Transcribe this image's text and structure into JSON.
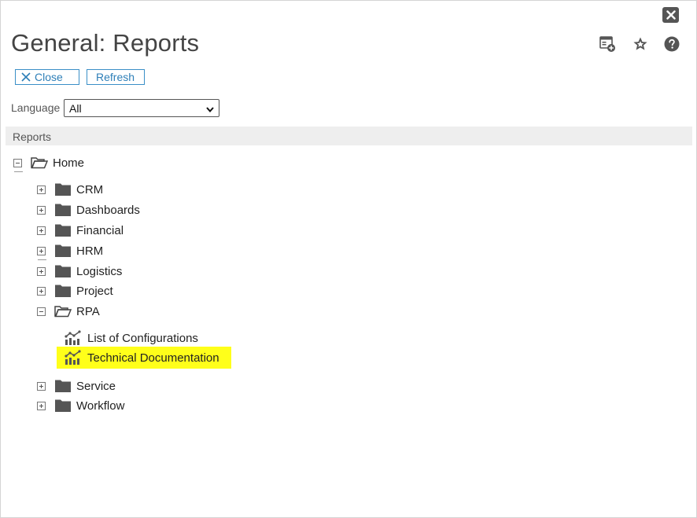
{
  "window": {
    "title": "General: Reports"
  },
  "toolbar": {
    "close_label": "Close",
    "refresh_label": "Refresh"
  },
  "filter": {
    "language_label": "Language",
    "language_value": "All"
  },
  "section": {
    "header": "Reports"
  },
  "tree": {
    "root": "Home",
    "folders": [
      {
        "label": "CRM",
        "expanded": false
      },
      {
        "label": "Dashboards",
        "expanded": false
      },
      {
        "label": "Financial",
        "expanded": false
      },
      {
        "label": "HRM",
        "expanded": false
      },
      {
        "label": "Logistics",
        "expanded": false
      },
      {
        "label": "Project",
        "expanded": false
      },
      {
        "label": "RPA",
        "expanded": true
      },
      {
        "label": "Service",
        "expanded": false
      },
      {
        "label": "Workflow",
        "expanded": false
      }
    ],
    "rpa_reports": [
      {
        "label": "List of Configurations",
        "selected": false
      },
      {
        "label": "Technical Documentation",
        "selected": true
      }
    ]
  },
  "icons": {
    "close_window": "close-icon",
    "add_dashboard": "add-to-dashboard-icon",
    "favorite": "star-icon",
    "help": "help-icon",
    "folder_closed": "folder-icon",
    "folder_open": "folder-open-icon",
    "report": "report-chart-icon"
  },
  "colors": {
    "accent": "#2e7fb8",
    "highlight": "#ffff1a",
    "icon_gray": "#555555"
  }
}
